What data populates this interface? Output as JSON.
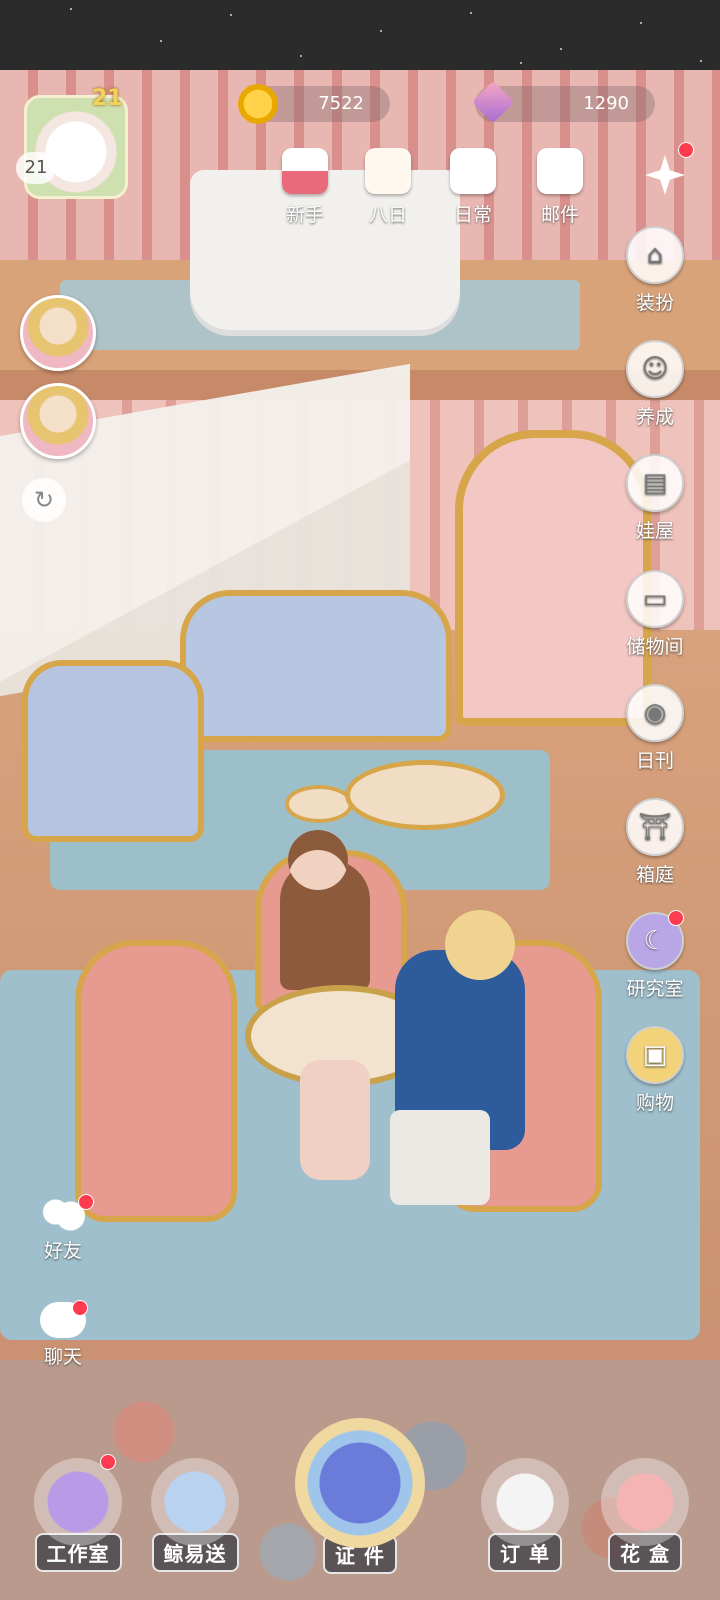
{
  "hud": {
    "player_level": "21",
    "player_level_small": "21",
    "gold": "7522",
    "gems": "1290"
  },
  "top_menu": [
    {
      "label": "新手",
      "icon": "bunny-cake-icon"
    },
    {
      "label": "八日",
      "icon": "eight-day-icon"
    },
    {
      "label": "日常",
      "icon": "clipboard-icon"
    },
    {
      "label": "邮件",
      "icon": "mail-icon"
    }
  ],
  "side_menu": [
    {
      "label": "装扮",
      "icon": "hanger-icon",
      "badge": false
    },
    {
      "label": "养成",
      "icon": "doll-icon",
      "badge": false
    },
    {
      "label": "娃屋",
      "icon": "cabinet-icon",
      "badge": false
    },
    {
      "label": "储物间",
      "icon": "box-icon",
      "badge": false
    },
    {
      "label": "日刊",
      "icon": "camera-icon",
      "badge": false
    },
    {
      "label": "箱庭",
      "icon": "garden-icon",
      "badge": false
    },
    {
      "label": "研究室",
      "icon": "moon-star-icon",
      "badge": true
    },
    {
      "label": "购物",
      "icon": "shopping-bag-icon",
      "badge": false
    }
  ],
  "left_misc": [
    {
      "label": "好友",
      "icon": "friends-icon"
    },
    {
      "label": "聊天",
      "icon": "chat-bubble-icon"
    }
  ],
  "bottom_nav": [
    {
      "label": "工作室",
      "icon": "scissors-book-icon"
    },
    {
      "label": "鲸易送",
      "icon": "delivery-box-icon"
    },
    {
      "label": "证 件",
      "icon": "whale-emblem-icon"
    },
    {
      "label": "订 单",
      "icon": "order-paper-icon"
    },
    {
      "label": "花 盒",
      "icon": "flower-box-icon"
    }
  ],
  "colors": {
    "badge": "#ff3b4f",
    "gold": "#f5d35a",
    "hud_text": "#ffffff"
  }
}
